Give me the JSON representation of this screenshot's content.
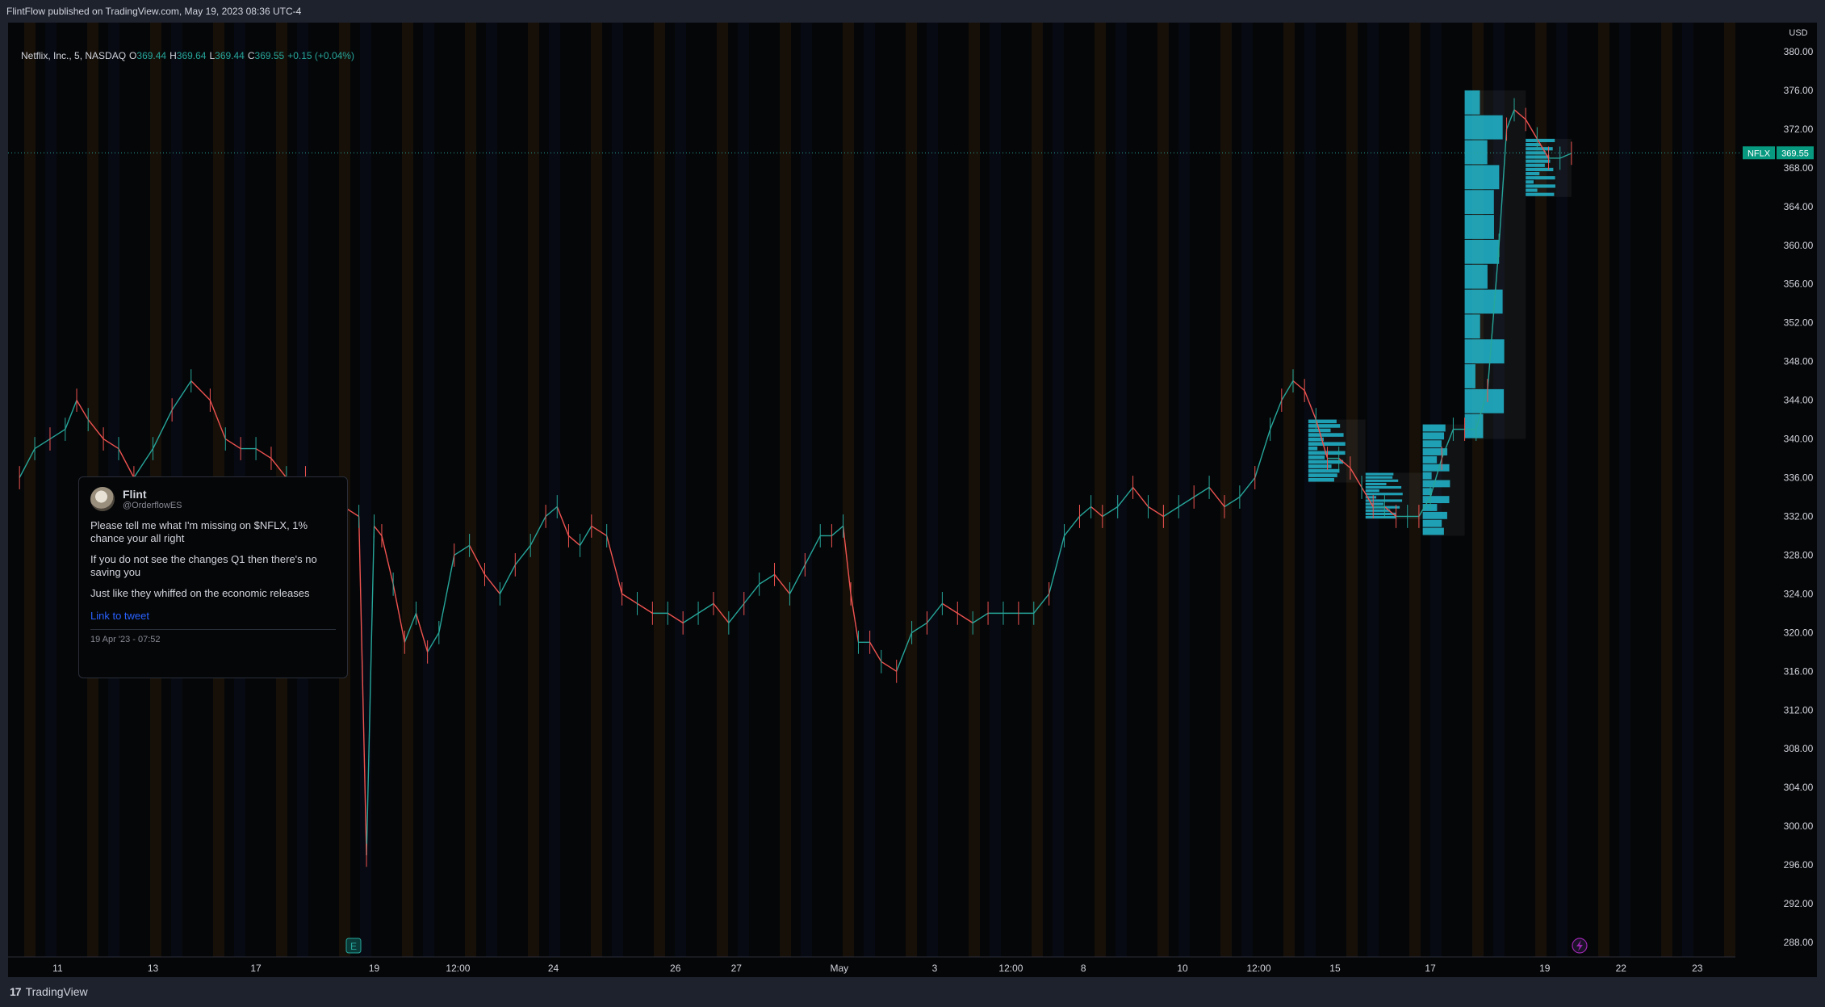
{
  "header": {
    "published_text": "FlintFlow published on TradingView.com, May 19, 2023 08:36 UTC-4"
  },
  "legend": {
    "symbol": "Netflix, Inc., 5, NASDAQ",
    "o_label": "O",
    "o_value": "369.44",
    "h_label": "H",
    "h_value": "369.64",
    "l_label": "L",
    "l_value": "369.44",
    "c_label": "C",
    "c_value": "369.55",
    "change": "+0.15 (+0.04%)"
  },
  "footer": {
    "brand": "TradingView",
    "brand_mark": "17"
  },
  "markers": {
    "earnings_label": "E",
    "flash_icon": "lightning-icon"
  },
  "price_badge": {
    "symbol": "NFLX",
    "price": "369.55"
  },
  "tweet": {
    "name": "Flint",
    "handle": "@OrderflowES",
    "line1": "Please tell me what I'm missing on $NFLX, 1% chance your all right",
    "line2": "If you do not see the changes Q1 then there's no saving you",
    "line3": "Just like they whiffed on the economic releases",
    "link_text": "Link to tweet",
    "date": "19 Apr '23 - 07:52"
  },
  "colors": {
    "up": "#26a69a",
    "down": "#ef5350",
    "background": "#050608",
    "profile": "#22b8cf",
    "price_line": "#26a69a"
  },
  "chart_data": {
    "type": "line",
    "title": "",
    "xlabel": "",
    "ylabel": "",
    "currency": "USD",
    "ylim": [
      286.5,
      383
    ],
    "y_ticks": [
      288,
      292,
      296,
      300,
      304,
      308,
      312,
      316,
      320,
      324,
      328,
      332,
      336,
      340,
      344,
      348,
      352,
      356,
      360,
      364,
      368,
      372,
      376,
      380
    ],
    "x_ticks": [
      "11",
      "13",
      "17",
      "19",
      "12:00",
      "24",
      "26",
      "27",
      "May",
      "3",
      "12:00",
      "8",
      "10",
      "12:00",
      "15",
      "17",
      "19",
      "22",
      "23"
    ],
    "x_tick_index": [
      1.0,
      3.5,
      6.2,
      9.3,
      11.5,
      14.0,
      17.2,
      18.8,
      21.5,
      24.0,
      26.0,
      27.9,
      30.5,
      32.5,
      34.5,
      37.0,
      40.0,
      42.0,
      44.0
    ],
    "grid": false,
    "series": [
      {
        "x": [
          0.0,
          0.4,
          0.8,
          1.2,
          1.5,
          1.8,
          2.2,
          2.6,
          3.0,
          3.5,
          4.0,
          4.5,
          5.0,
          5.4,
          5.8,
          6.2,
          6.6,
          7.0,
          7.5,
          8.0,
          8.5,
          8.9,
          9.1,
          9.3,
          9.5,
          9.8,
          10.1,
          10.4,
          10.7,
          11.0,
          11.4,
          11.8,
          12.2,
          12.6,
          13.0,
          13.4,
          13.8,
          14.1,
          14.4,
          14.7,
          15.0,
          15.4,
          15.8,
          16.2,
          16.6,
          17.0,
          17.4,
          17.8,
          18.2,
          18.6,
          19.0,
          19.4,
          19.8,
          20.2,
          20.6,
          21.0,
          21.3,
          21.6,
          21.8,
          22.0,
          22.3,
          22.6,
          23.0,
          23.4,
          23.8,
          24.2,
          24.6,
          25.0,
          25.4,
          25.8,
          26.2,
          26.6,
          27.0,
          27.4,
          27.8,
          28.1,
          28.4,
          28.8,
          29.2,
          29.6,
          30.0,
          30.4,
          30.8,
          31.2,
          31.6,
          32.0,
          32.4,
          32.8,
          33.1,
          33.4,
          33.7,
          34.0,
          34.3,
          34.6,
          34.9,
          35.2,
          35.5,
          35.8,
          36.1,
          36.4,
          36.7,
          37.0,
          37.3,
          37.6,
          37.9,
          38.2,
          38.5,
          38.8,
          39.0,
          39.2,
          39.5,
          39.8,
          40.1,
          40.4,
          40.7
        ],
        "values": [
          336,
          339,
          340,
          341,
          344,
          342,
          340,
          339,
          336,
          339,
          343,
          346,
          344,
          340,
          339,
          339,
          338,
          336,
          336,
          334,
          333,
          332,
          297,
          331,
          330,
          325,
          319,
          322,
          318,
          320,
          328,
          329,
          326,
          324,
          327,
          329,
          332,
          333,
          330,
          329,
          331,
          330,
          324,
          323,
          322,
          322,
          321,
          322,
          323,
          321,
          323,
          325,
          326,
          324,
          327,
          330,
          330,
          331,
          324,
          319,
          319,
          317,
          316,
          320,
          321,
          323,
          322,
          321,
          322,
          322,
          322,
          322,
          324,
          330,
          332,
          333,
          332,
          333,
          335,
          333,
          332,
          333,
          334,
          335,
          333,
          334,
          336,
          341,
          344,
          346,
          345,
          342,
          338,
          338,
          337,
          335,
          333,
          333,
          332,
          332,
          332,
          334,
          338,
          341,
          341,
          341,
          345,
          360,
          372,
          374,
          373,
          371,
          369,
          369,
          369.5
        ]
      }
    ],
    "last_price": 369.55
  }
}
